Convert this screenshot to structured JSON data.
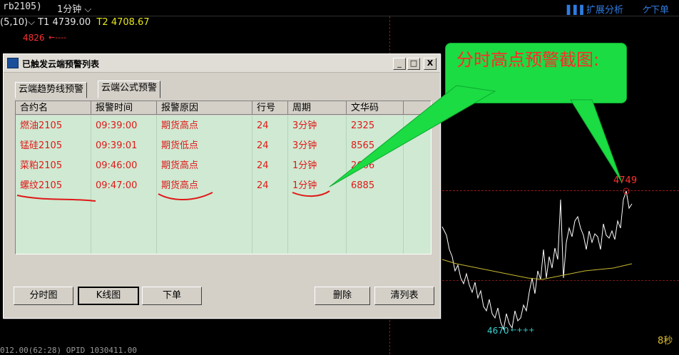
{
  "header": {
    "symbol": "rb2105)",
    "period": "1分钟",
    "tools_label": "扩展分析",
    "order_label": "下单",
    "ma_label": "(5,10)",
    "t1": "T1 4739.00",
    "t2": "T2 4708.67"
  },
  "chart": {
    "high_label": "4826",
    "peak_label": "4749",
    "low_label": "4670",
    "seconds_label": "8秒",
    "status_text": "012.00(62:28)  OPID 1030411.00"
  },
  "dialog": {
    "title": "已触发云端预警列表",
    "btn_min": "_",
    "btn_max": "□",
    "btn_close": "X",
    "tabs": [
      "云端趋势线预警",
      "云端公式预警"
    ],
    "columns": [
      "合约名",
      "报警时间",
      "报警原因",
      "行号",
      "周期",
      "文华码"
    ],
    "rows": [
      [
        "燃油2105",
        "09:39:00",
        "期货高点",
        "24",
        "3分钟",
        "2325"
      ],
      [
        "锰硅2105",
        "09:39:01",
        "期货低点",
        "24",
        "3分钟",
        "8565"
      ],
      [
        "菜粕2105",
        "09:46:00",
        "期货高点",
        "24",
        "1分钟",
        "2666"
      ],
      [
        "螺纹2105",
        "09:47:00",
        "期货高点",
        "24",
        "1分钟",
        "6885"
      ]
    ],
    "buttons": {
      "timeshare": "分时图",
      "kline": "K线图",
      "order": "下单",
      "delete": "删除",
      "clear": "清列表"
    }
  },
  "annotation": {
    "text": "分时高点预警截图:",
    "color": "#1bdc43",
    "text_color": "#ff2a2a",
    "underline_color": "#e01818"
  },
  "colors": {
    "price_line": "#ffffff",
    "avg_line": "#c8b830",
    "alert_text": "#e01818",
    "grid_bg": "#cfe9d2"
  }
}
